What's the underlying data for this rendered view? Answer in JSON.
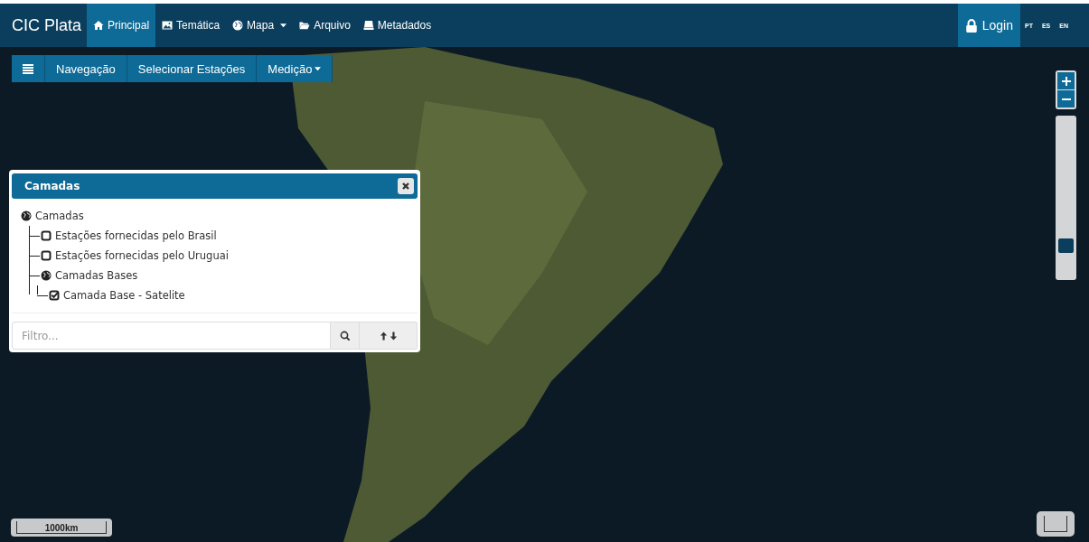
{
  "navbar": {
    "brand": "CIC Plata",
    "items": [
      {
        "label": "Principal",
        "selected": true,
        "dropdown": false
      },
      {
        "label": "Temática",
        "selected": false,
        "dropdown": false
      },
      {
        "label": "Mapa",
        "selected": false,
        "dropdown": true
      },
      {
        "label": "Arquivo",
        "selected": false,
        "dropdown": false
      },
      {
        "label": "Metadados",
        "selected": false,
        "dropdown": false
      }
    ],
    "login": "Login",
    "languages": [
      "PT",
      "ES",
      "EN"
    ]
  },
  "toolbar": {
    "items": [
      {
        "label": "Navegação",
        "dropdown": false
      },
      {
        "label": "Selecionar Estações",
        "dropdown": false
      },
      {
        "label": "Medição",
        "dropdown": true
      }
    ]
  },
  "layers_panel": {
    "title": "Camadas",
    "tree": [
      {
        "kind": "group",
        "label": "Camadas",
        "children": [
          {
            "kind": "layer",
            "label": "Estações fornecidas pelo Brasil",
            "checked": false
          },
          {
            "kind": "layer",
            "label": "Estações fornecidas pelo Uruguai",
            "checked": false
          },
          {
            "kind": "group",
            "label": "Camadas Bases",
            "children": [
              {
                "kind": "layer",
                "label": "Camada Base - Satelite",
                "checked": true
              }
            ]
          }
        ]
      }
    ],
    "filter": {
      "placeholder": "Filtro..."
    }
  },
  "zoom": {
    "level": 0.2
  },
  "scale": "1000km"
}
